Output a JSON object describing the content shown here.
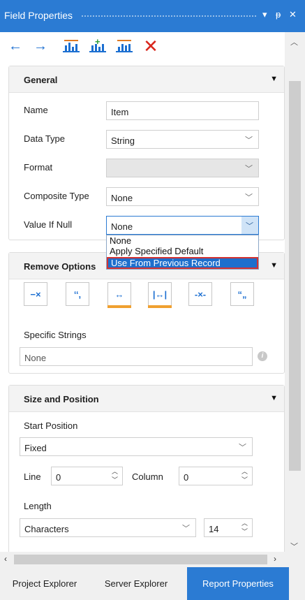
{
  "window": {
    "title": "Field Properties",
    "controls": {
      "menu": "▾",
      "pin": "ᵽ",
      "close": "✕"
    }
  },
  "toolbar": {
    "items": [
      "back-arrow",
      "forward-arrow",
      "columns-icon",
      "add-column-icon",
      "move-column-icon",
      "delete-icon"
    ]
  },
  "general": {
    "title": "General",
    "name": {
      "label": "Name",
      "value": "Item"
    },
    "data_type": {
      "label": "Data Type",
      "value": "String"
    },
    "format": {
      "label": "Format",
      "value": ""
    },
    "composite_type": {
      "label": "Composite Type",
      "value": "None"
    },
    "value_if_null": {
      "label": "Value If Null",
      "value": "None",
      "options": [
        "None",
        "Apply Specified Default",
        "Use From Previous Record"
      ],
      "highlighted_option": "Use From Previous Record"
    }
  },
  "remove_options": {
    "title": "Remove Options",
    "buttons": [
      {
        "glyph": "−×",
        "icon": "remove-leading-chars-icon",
        "active": false
      },
      {
        "glyph": "‘‘,",
        "icon": "remove-leading-quote-icon",
        "active": false
      },
      {
        "glyph": "↔",
        "icon": "trim-spaces-icon",
        "active": true
      },
      {
        "glyph": "|↔|",
        "icon": "trim-bounded-spaces-icon",
        "active": true
      },
      {
        "glyph": "-×-",
        "icon": "remove-inner-chars-icon",
        "active": false
      },
      {
        "glyph": "“„",
        "icon": "remove-quotes-icon",
        "active": false
      }
    ],
    "specific_strings": {
      "label": "Specific Strings",
      "value": "None"
    }
  },
  "size_position": {
    "title": "Size and Position",
    "start_position": {
      "label": "Start Position",
      "value": "Fixed"
    },
    "line": {
      "label": "Line",
      "value": "0"
    },
    "column": {
      "label": "Column",
      "value": "0"
    },
    "length": {
      "label": "Length",
      "value": "Characters",
      "count": "14"
    }
  },
  "tabs": [
    {
      "label": "Project Explorer",
      "active": false
    },
    {
      "label": "Server Explorer",
      "active": false
    },
    {
      "label": "Report Properties",
      "active": true
    }
  ],
  "colors": {
    "accent": "#2b7bd3",
    "highlight_border": "#d23232",
    "toolbar_blue": "#1c6fd1",
    "delete_red": "#d9261c",
    "active_underline": "#f0a030"
  }
}
